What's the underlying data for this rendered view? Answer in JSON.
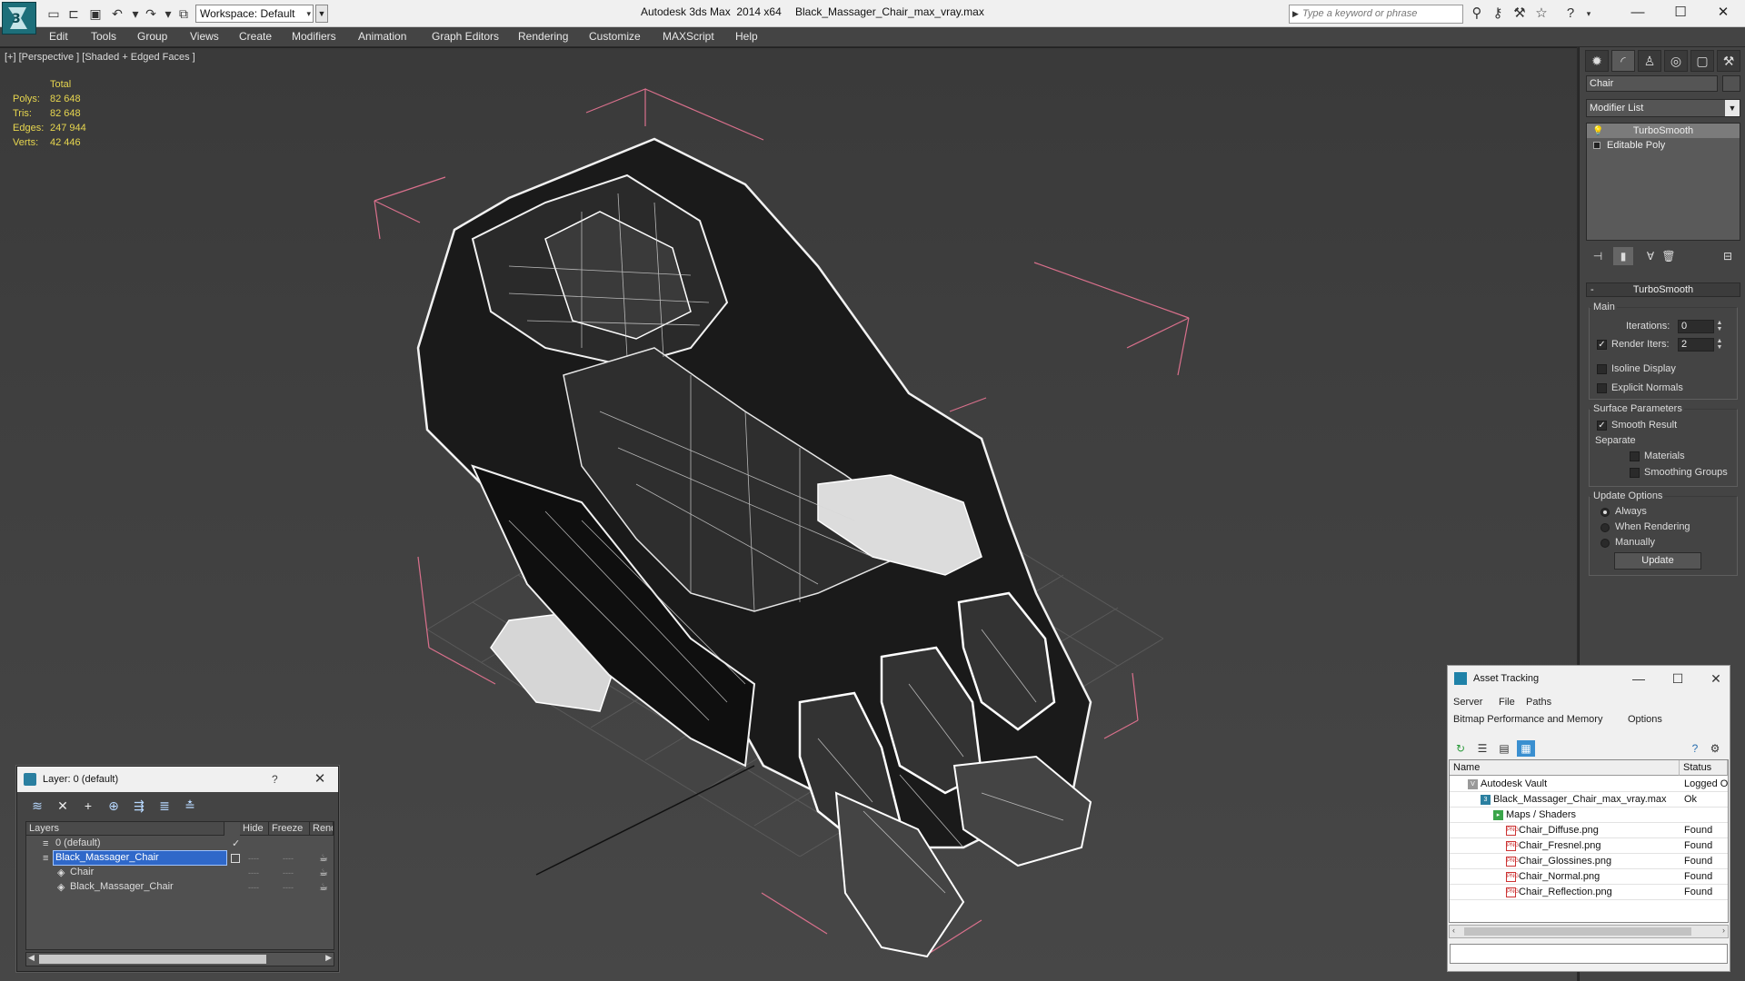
{
  "titlebar": {
    "workspace": "Workspace: Default",
    "app_title": "Autodesk 3ds Max  2014 x64",
    "file_title": "Black_Massager_Chair_max_vray.max",
    "search_placeholder": "Type a keyword or phrase"
  },
  "menu": [
    "Edit",
    "Tools",
    "Group",
    "Views",
    "Create",
    "Modifiers",
    "Animation",
    "Graph Editors",
    "Rendering",
    "Customize",
    "MAXScript",
    "Help"
  ],
  "viewport": {
    "label": "[+] [Perspective ] [Shaded + Edged Faces ]",
    "stats": {
      "header": "Total",
      "rows": [
        {
          "label": "Polys:",
          "value": "82 648"
        },
        {
          "label": "Tris:",
          "value": "82 648"
        },
        {
          "label": "Edges:",
          "value": "247 944"
        },
        {
          "label": "Verts:",
          "value": "42 446"
        }
      ]
    }
  },
  "command_panel": {
    "object_name": "Chair",
    "modifier_list": "Modifier List",
    "stack": [
      "TurboSmooth",
      "Editable Poly"
    ],
    "rollout_title": "TurboSmooth",
    "main_group": "Main",
    "iterations_label": "Iterations:",
    "iterations_value": "0",
    "render_iters_label": "Render Iters:",
    "render_iters_value": "2",
    "isoline_label": "Isoline Display",
    "explicit_normals_label": "Explicit Normals",
    "surface_group": "Surface Parameters",
    "smooth_result_label": "Smooth Result",
    "separate_label": "Separate",
    "materials_label": "Materials",
    "smoothing_groups_label": "Smoothing Groups",
    "update_group": "Update Options",
    "always_label": "Always",
    "when_rendering_label": "When Rendering",
    "manually_label": "Manually",
    "update_button": "Update"
  },
  "layer_dialog": {
    "title": "Layer: 0 (default)",
    "help": "?",
    "columns": [
      "Layers",
      "Hide",
      "Freeze",
      "Rend"
    ],
    "rows": [
      {
        "name": "0 (default)"
      },
      {
        "name": "Black_Massager_Chair"
      },
      {
        "name": "Chair"
      },
      {
        "name": "Black_Massager_Chair"
      }
    ],
    "dash": "----"
  },
  "asset_dialog": {
    "title": "Asset Tracking",
    "menu1": [
      "Server",
      "File",
      "Paths"
    ],
    "menu2": [
      "Bitmap Performance and Memory",
      "Options"
    ],
    "columns": [
      "Name",
      "Status"
    ],
    "rows": [
      {
        "name": "Autodesk Vault",
        "status": "Logged O"
      },
      {
        "name": "Black_Massager_Chair_max_vray.max",
        "status": "Ok"
      },
      {
        "name": "Maps / Shaders",
        "status": ""
      },
      {
        "name": "Chair_Diffuse.png",
        "status": "Found"
      },
      {
        "name": "Chair_Fresnel.png",
        "status": "Found"
      },
      {
        "name": "Chair_Glossines.png",
        "status": "Found"
      },
      {
        "name": "Chair_Normal.png",
        "status": "Found"
      },
      {
        "name": "Chair_Reflection.png",
        "status": "Found"
      }
    ]
  },
  "colors": {
    "stats_yellow": "#e7d64f",
    "bbox_pink": "#d9708c",
    "selection_blue": "#2f68c9",
    "wire_white": "#f2f2f2"
  },
  "icons": {
    "app": "3dsmax-logo-icon",
    "new": "new-file-icon",
    "open": "open-file-icon",
    "save": "save-icon",
    "undo": "undo-icon",
    "redo": "redo-icon"
  }
}
